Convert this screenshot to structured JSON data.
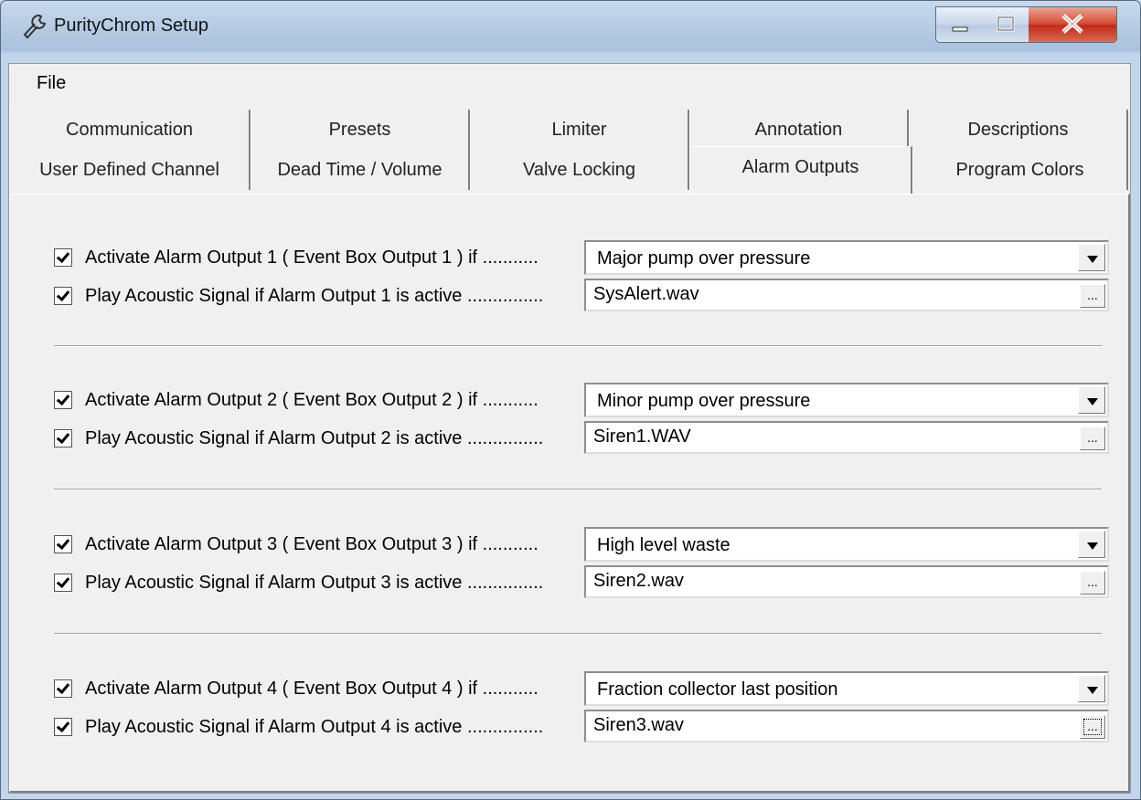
{
  "window": {
    "title": "PurityChrom Setup"
  },
  "menu": {
    "file": "File"
  },
  "tabs_row1": [
    "Communication",
    "Presets",
    "Limiter",
    "Annotation",
    "Descriptions"
  ],
  "tabs_row2": [
    "User Defined Channel",
    "Dead Time / Volume",
    "Valve Locking",
    "Alarm Outputs",
    "Program Colors"
  ],
  "active_tab": "Alarm Outputs",
  "alarms": [
    {
      "activate_label": "Activate Alarm Output 1 ( Event Box Output 1 )  if ...........",
      "activate_checked": true,
      "condition": "Major pump over pressure",
      "sound_label": "Play Acoustic Signal if Alarm Output 1 is active ...............",
      "sound_checked": true,
      "sound_file": "SysAlert.wav",
      "browse_label": "..."
    },
    {
      "activate_label": "Activate Alarm Output 2 ( Event Box Output 2 )  if ...........",
      "activate_checked": true,
      "condition": "Minor pump over pressure",
      "sound_label": "Play Acoustic Signal if Alarm Output 2 is active ...............",
      "sound_checked": true,
      "sound_file": "Siren1.WAV",
      "browse_label": "..."
    },
    {
      "activate_label": "Activate Alarm Output 3 ( Event Box Output 3 )  if ...........",
      "activate_checked": true,
      "condition": "High level waste",
      "sound_label": "Play Acoustic Signal if Alarm Output 3 is active ...............",
      "sound_checked": true,
      "sound_file": "Siren2.wav",
      "browse_label": "..."
    },
    {
      "activate_label": "Activate Alarm Output 4 ( Event Box Output 4 )  if ...........",
      "activate_checked": true,
      "condition": "Fraction collector last position",
      "sound_label": "Play Acoustic Signal if Alarm Output 4 is active ...............",
      "sound_checked": true,
      "sound_file": "Siren3.wav",
      "browse_label": "..."
    }
  ],
  "colors": {
    "close_button": "#c0281a",
    "face": "#f0f0f0"
  }
}
